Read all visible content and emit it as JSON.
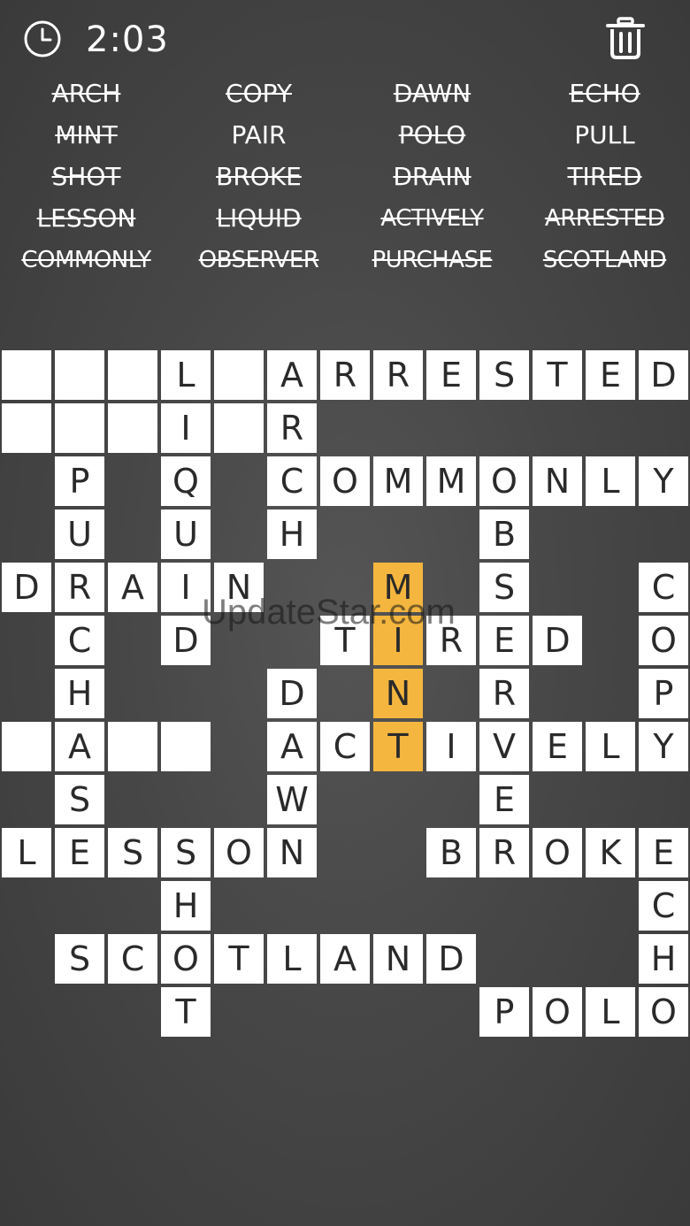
{
  "header": {
    "timer": "2:03",
    "clock_icon": "clock-icon",
    "trash_icon": "trash-icon"
  },
  "words": [
    {
      "text": "ARCH",
      "found": true
    },
    {
      "text": "COPY",
      "found": true
    },
    {
      "text": "DAWN",
      "found": true
    },
    {
      "text": "ECHO",
      "found": true
    },
    {
      "text": "MINT",
      "found": true
    },
    {
      "text": "PAIR",
      "found": false
    },
    {
      "text": "POLO",
      "found": true
    },
    {
      "text": "PULL",
      "found": false
    },
    {
      "text": "SHOT",
      "found": true
    },
    {
      "text": "BROKE",
      "found": true
    },
    {
      "text": "DRAIN",
      "found": true
    },
    {
      "text": "TIRED",
      "found": true
    },
    {
      "text": "LESSON",
      "found": true
    },
    {
      "text": "LIQUID",
      "found": true
    },
    {
      "text": "ACTIVELY",
      "found": true
    },
    {
      "text": "ARRESTED",
      "found": true
    },
    {
      "text": "COMMONLY",
      "found": true
    },
    {
      "text": "OBSERVER",
      "found": true
    },
    {
      "text": "PURCHASE",
      "found": true
    },
    {
      "text": "SCOTLAND",
      "found": true
    }
  ],
  "grid": [
    "___L_ARRESTED",
    "___I_R.......",
    ".P.Q.COMMONLY",
    ".U.U.H...B...",
    "DRAIN..M.S..C",
    ".C.D..TIRED.O",
    ".H...D.N.R..P",
    "_A__.ACTIVELY",
    ".S...W...E...",
    "LESSON..BROKE",
    "...H........C",
    ".SCOTLAND...H",
    "...T.....POLO"
  ],
  "highlighted": [
    "4,7",
    "5,7",
    "6,7",
    "7,7"
  ],
  "colors": {
    "highlight": "#f4b63f",
    "tile": "#ffffff",
    "background": "#474747"
  },
  "watermark": "UpdateStar.com"
}
